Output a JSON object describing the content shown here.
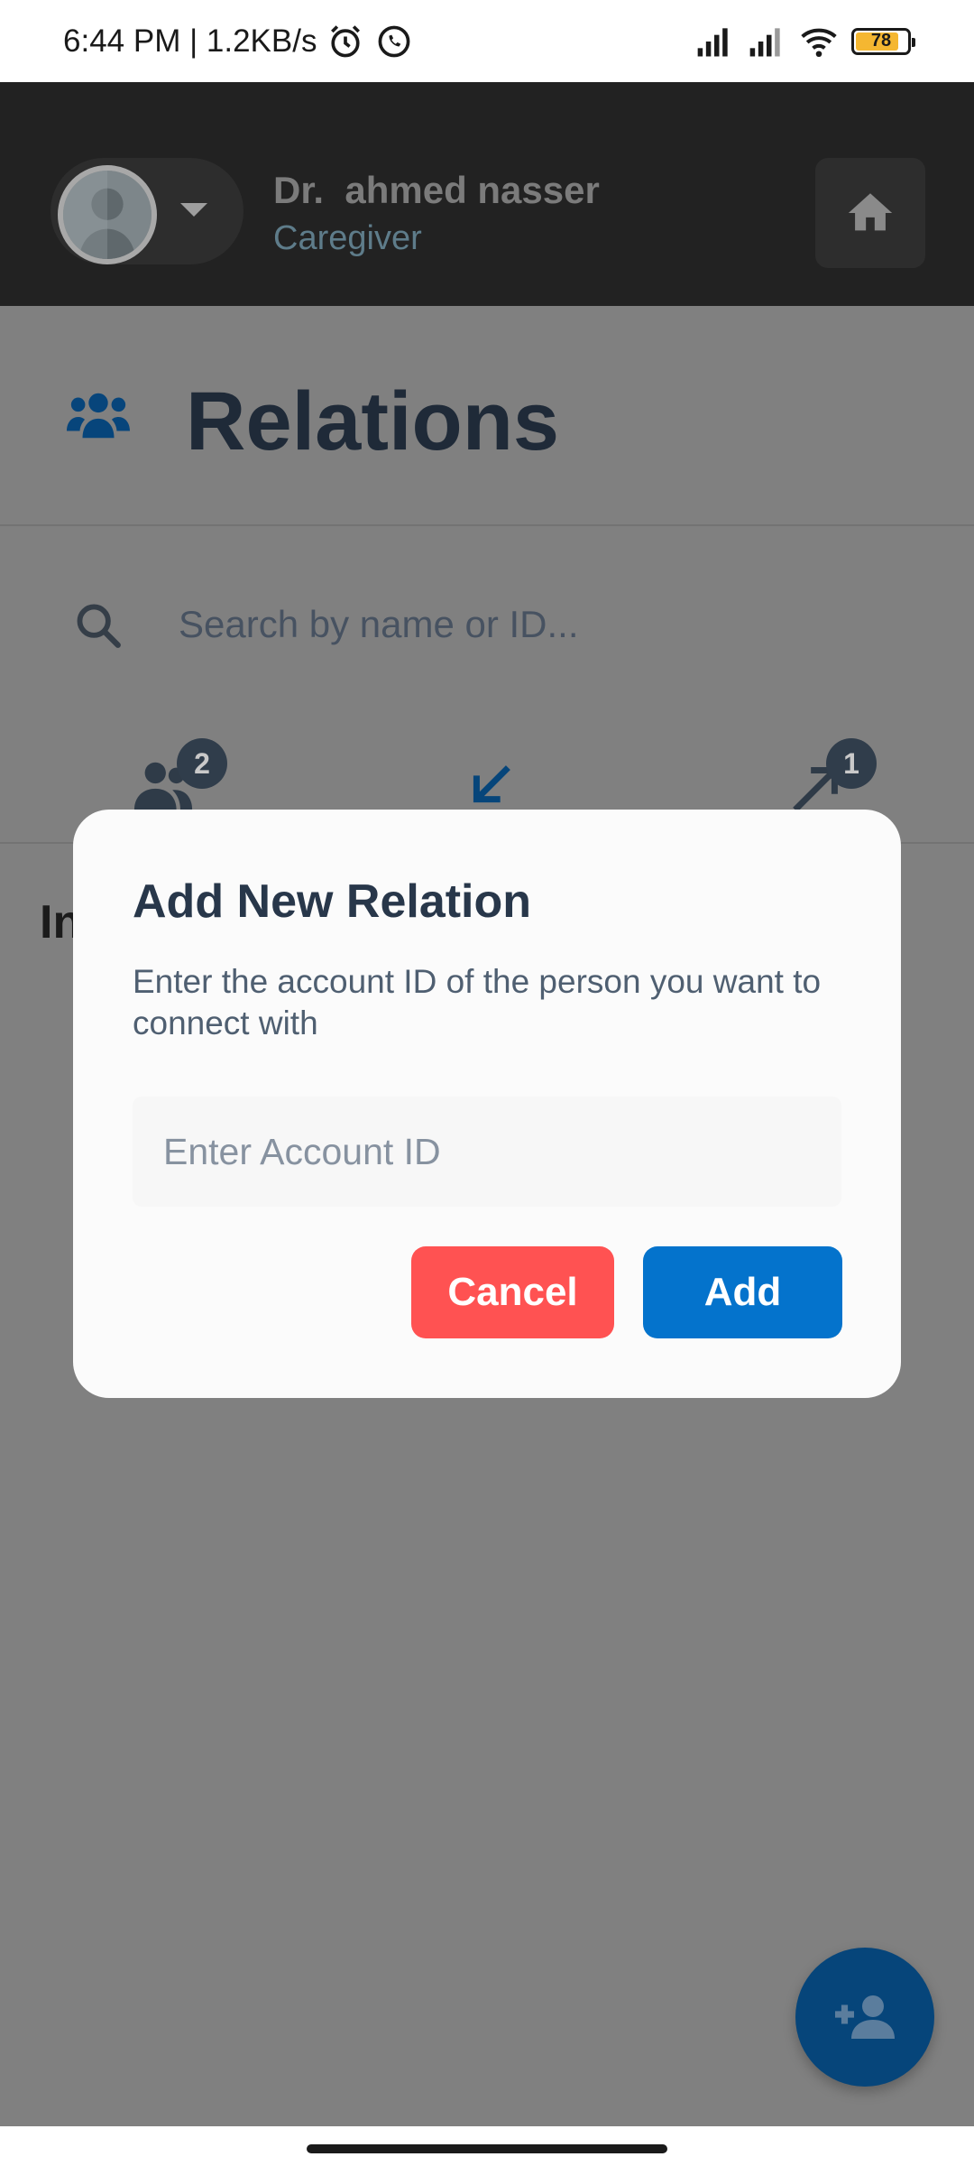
{
  "status_bar": {
    "time_speed": "6:44 PM | 1.2KB/s",
    "battery_level": "78"
  },
  "header": {
    "user_name": "Dr.  ahmed nasser",
    "user_role": "Caregiver"
  },
  "page": {
    "title": "Relations",
    "search_placeholder": "Search by name or ID...",
    "tabs": [
      {
        "icon": "people-icon",
        "badge": "2"
      },
      {
        "icon": "arrow-incoming-icon",
        "badge": ""
      },
      {
        "icon": "arrow-outgoing-icon",
        "badge": "1"
      }
    ],
    "partial_heading": "In"
  },
  "dialog": {
    "title": "Add New Relation",
    "description": "Enter the account ID of the person you want to connect with",
    "input_placeholder": "Enter Account ID",
    "cancel_label": "Cancel",
    "add_label": "Add"
  },
  "colors": {
    "overlay": "#808080",
    "cancel": "#ff5252",
    "add": "#0473cc",
    "fab": "#06457a"
  }
}
